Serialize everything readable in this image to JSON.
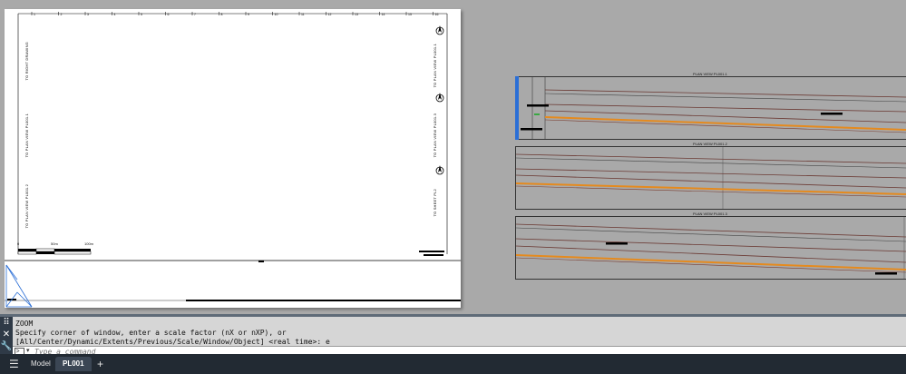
{
  "sheet": {
    "ruler_ticks": [
      "1",
      "2",
      "3",
      "4",
      "5",
      "6",
      "7",
      "8",
      "9",
      "10",
      "11",
      "12",
      "13",
      "14",
      "15",
      "16"
    ],
    "left_labels": [
      "TO RIGHT DRAWING",
      "TO PLAN VIEW PL001.1",
      "TO PLAN VIEW PL001.2"
    ],
    "right_labels": [
      "TO PLAN VIEW PL001.1",
      "TO PLAN VIEW PL001.3",
      "TO SHEET PL2"
    ],
    "scale_bar": [
      "0",
      "50m",
      "100m"
    ]
  },
  "viewports": [
    {
      "title": "PLAN VIEW PL001.1"
    },
    {
      "title": "PLAN VIEW PL001.2"
    },
    {
      "title": "PLAN VIEW PL001.3"
    }
  ],
  "command": {
    "line1": "ZOOM",
    "line2": "Specify corner of window, enter a scale factor (nX or nXP), or",
    "line3": "[All/Center/Dynamic/Extents/Previous/Scale/Window/Object] <real time>: e",
    "placeholder": "Type a command"
  },
  "tabs": {
    "model": "Model",
    "layout": "PL001",
    "add": "+"
  },
  "colors": {
    "accent": "#e58a1e",
    "road_line": "#7a3b2e",
    "tabbar": "#222a33"
  }
}
